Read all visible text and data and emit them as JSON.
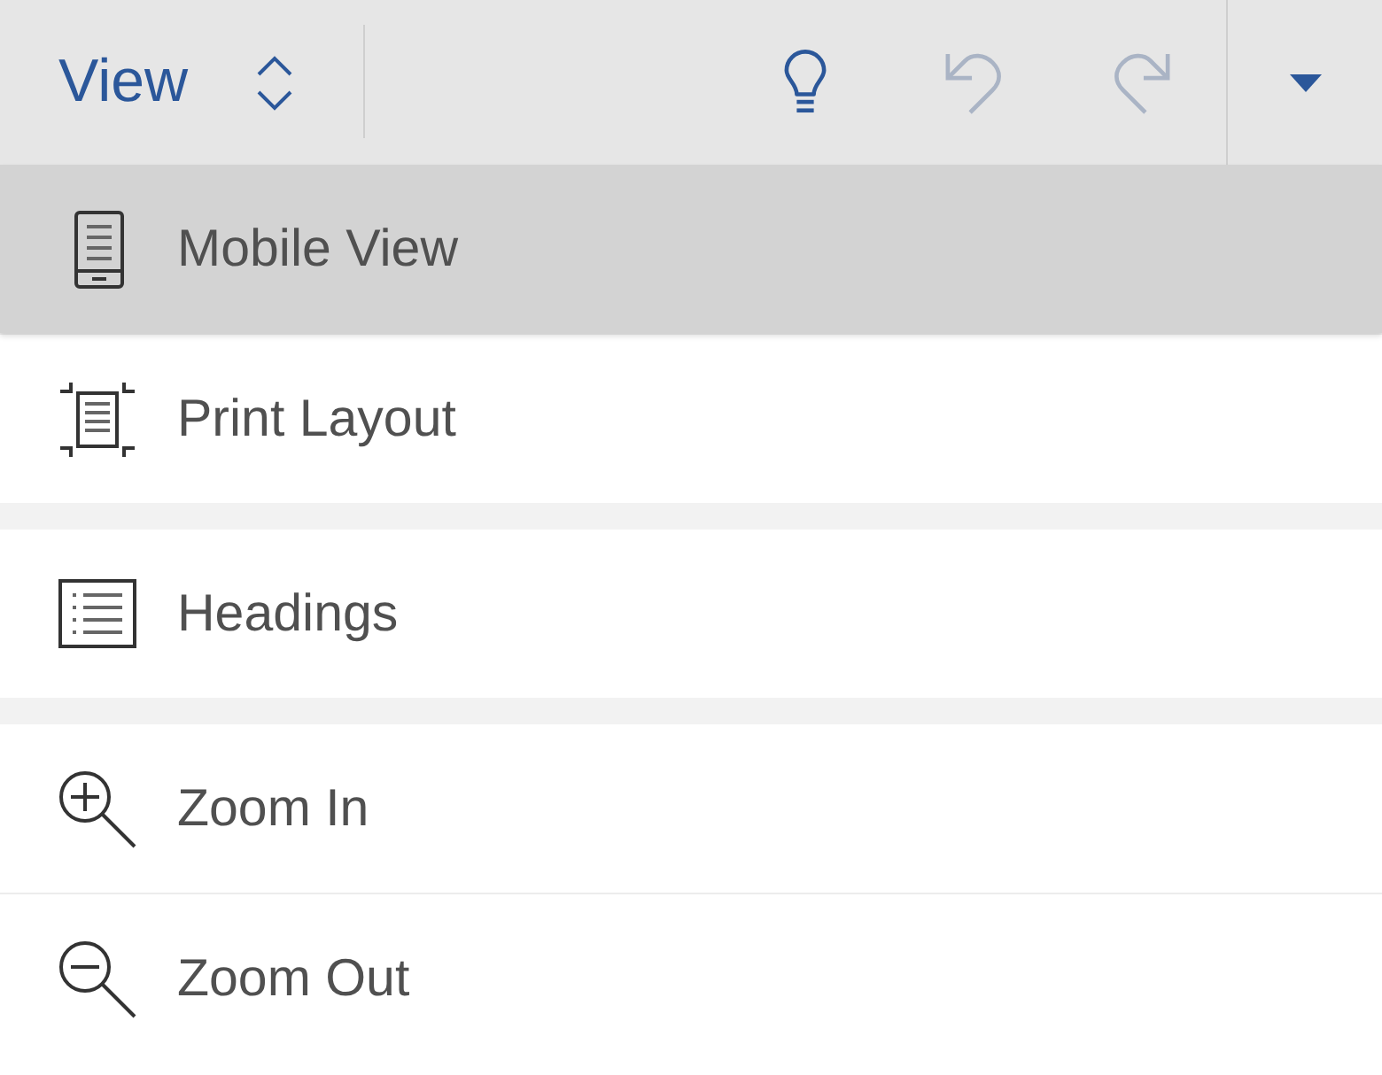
{
  "toolbar": {
    "title": "View",
    "actions": [
      {
        "kind": "tips",
        "disabled": false
      },
      {
        "kind": "undo",
        "disabled": true
      },
      {
        "kind": "redo",
        "disabled": true
      }
    ]
  },
  "menu": {
    "groups": [
      {
        "items": [
          {
            "kind": "mobile",
            "label": "Mobile View",
            "selected": true
          },
          {
            "kind": "print",
            "label": "Print Layout",
            "selected": false
          }
        ]
      },
      {
        "items": [
          {
            "kind": "headings",
            "label": "Headings",
            "selected": false
          }
        ]
      },
      {
        "items": [
          {
            "kind": "zoom-in",
            "label": "Zoom In",
            "selected": false
          },
          {
            "kind": "zoom-out",
            "label": "Zoom Out",
            "selected": false
          }
        ]
      }
    ]
  }
}
